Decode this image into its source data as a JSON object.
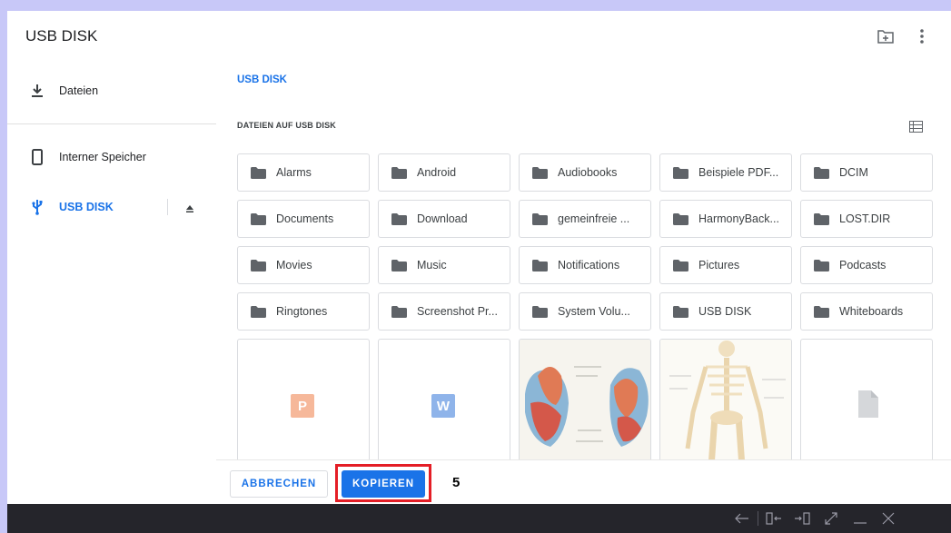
{
  "header": {
    "title": "USB DISK",
    "new_folder_icon": "new-folder-icon",
    "more_icon": "more-vert-icon"
  },
  "sidebar": {
    "items": [
      {
        "label": "Dateien",
        "icon": "download-icon"
      },
      {
        "label": "Interner Speicher",
        "icon": "phone-icon"
      },
      {
        "label": "USB DISK",
        "icon": "usb-icon",
        "active": true,
        "action_icon": "eject-icon"
      }
    ]
  },
  "main": {
    "breadcrumb": "USB DISK",
    "section_title": "DATEIEN AUF USB DISK",
    "view_toggle_icon": "list-view-icon",
    "folders": [
      "Alarms",
      "Android",
      "Audiobooks",
      "Beispiele PDF...",
      "DCIM",
      "Documents",
      "Download",
      "gemeinfreie ...",
      "HarmonyBack...",
      "LOST.DIR",
      "Movies",
      "Music",
      "Notifications",
      "Pictures",
      "Podcasts",
      "Ringtones",
      "Screenshot Pr...",
      "System Volu...",
      "USB DISK",
      "Whiteboards"
    ],
    "files": [
      {
        "type": "powerpoint",
        "badge": "P"
      },
      {
        "type": "word",
        "badge": "W"
      },
      {
        "type": "image-heart"
      },
      {
        "type": "image-skeleton"
      },
      {
        "type": "generic-file"
      }
    ]
  },
  "buttons": {
    "cancel": "ABBRECHEN",
    "copy": "KOPIEREN"
  },
  "annotation": {
    "step": "5"
  },
  "colors": {
    "accent": "#1a73e8",
    "highlight": "#e41e26",
    "background": "#c8c8f8",
    "system_bar": "#25252b"
  }
}
